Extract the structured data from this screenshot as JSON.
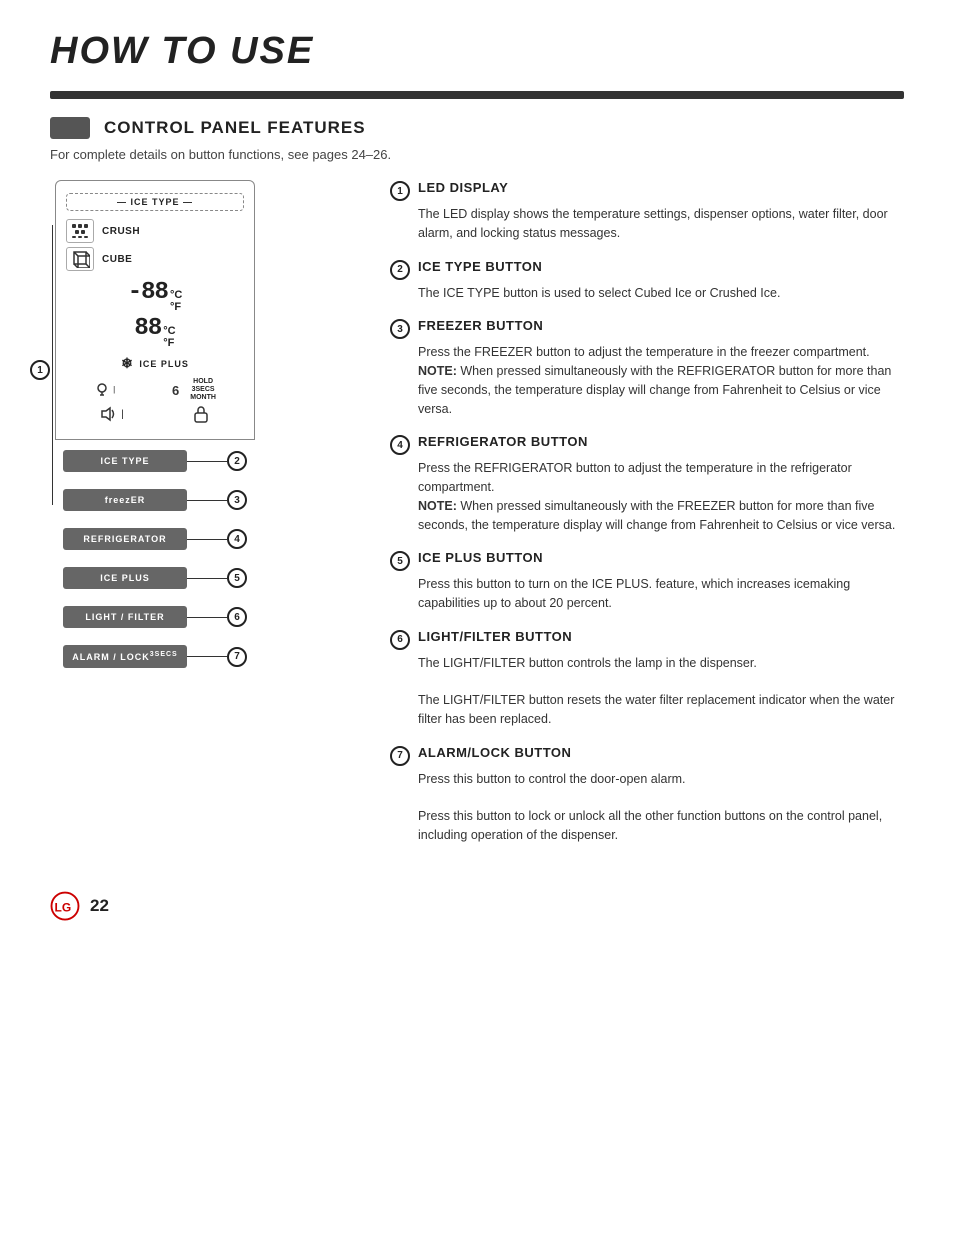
{
  "page": {
    "title": "HOW TO USE",
    "page_number": "22"
  },
  "section": {
    "title": "CONTROL PANEL FEATURES",
    "subtitle": "For complete details on button functions, see pages 24–26."
  },
  "diagram": {
    "label1": "①",
    "ice_type_label": "ICE TYPE",
    "crush_label": "CRUSH",
    "cube_label": "CUBE",
    "temp1_digits": "-88",
    "temp1_c": "°C",
    "temp1_f": "°F",
    "temp2_digits": "88",
    "temp2_c": "°C",
    "temp2_f": "°F",
    "ice_plus_label": "ICE PLUS",
    "hold_label": "HOLD\n3SECS\nMONTH",
    "buttons": [
      {
        "label": "ICE TYPE",
        "callout": "②"
      },
      {
        "label": "freezER",
        "callout": "③"
      },
      {
        "label": "REFRIGERATOR",
        "callout": "④"
      },
      {
        "label": "ICE PLUS",
        "callout": "⑤"
      },
      {
        "label": "LIGHT / FILTER",
        "callout": "⑥"
      },
      {
        "label": "ALARM / LOCK 3SECS",
        "callout": "⑦"
      }
    ]
  },
  "features": [
    {
      "number": "1",
      "title": "LED DISPLAY",
      "description": "The LED display shows the temperature settings, dispenser options, water filter, door alarm, and locking status messages.",
      "note": ""
    },
    {
      "number": "2",
      "title": "ICE TYPE BUTTON",
      "description": "The ICE TYPE button is used to select Cubed Ice or Crushed Ice.",
      "note": ""
    },
    {
      "number": "3",
      "title": "FREEZER BUTTON",
      "description": "Press the FREEZER button to adjust the temperature in the freezer compartment.",
      "note_label": "NOTE:",
      "note": "When pressed simultaneously with the REFRIGERATOR button for more than five seconds, the temperature display will change from Fahrenheit to Celsius or vice versa."
    },
    {
      "number": "4",
      "title": "REFRIGERATOR BUTTON",
      "description": "Press the REFRIGERATOR button to adjust the temperature in the refrigerator compartment.",
      "note_label": "NOTE:",
      "note": "When pressed simultaneously with the FREEZER button for more than five seconds, the temperature display will change from Fahrenheit to Celsius or vice versa."
    },
    {
      "number": "5",
      "title": "ICE PLUS BUTTON",
      "description": "Press this button to turn on the ICE PLUS. feature, which increases icemaking capabilities up to about 20 percent.",
      "note": ""
    },
    {
      "number": "6",
      "title": "LIGHT/FILTER BUTTON",
      "description1": "The LIGHT/FILTER button controls the lamp in the dispenser.",
      "description2": "The LIGHT/FILTER button resets the water filter replacement indicator when the water filter has been replaced.",
      "note": ""
    },
    {
      "number": "7",
      "title": "ALARM/LOCK BUTTON",
      "description1": "Press this button to control the door-open alarm.",
      "description2": "Press this button to lock or unlock all the other function buttons on the control panel, including operation of the dispenser.",
      "note": ""
    }
  ],
  "footer": {
    "logo_text": "LG",
    "page_number": "22"
  }
}
